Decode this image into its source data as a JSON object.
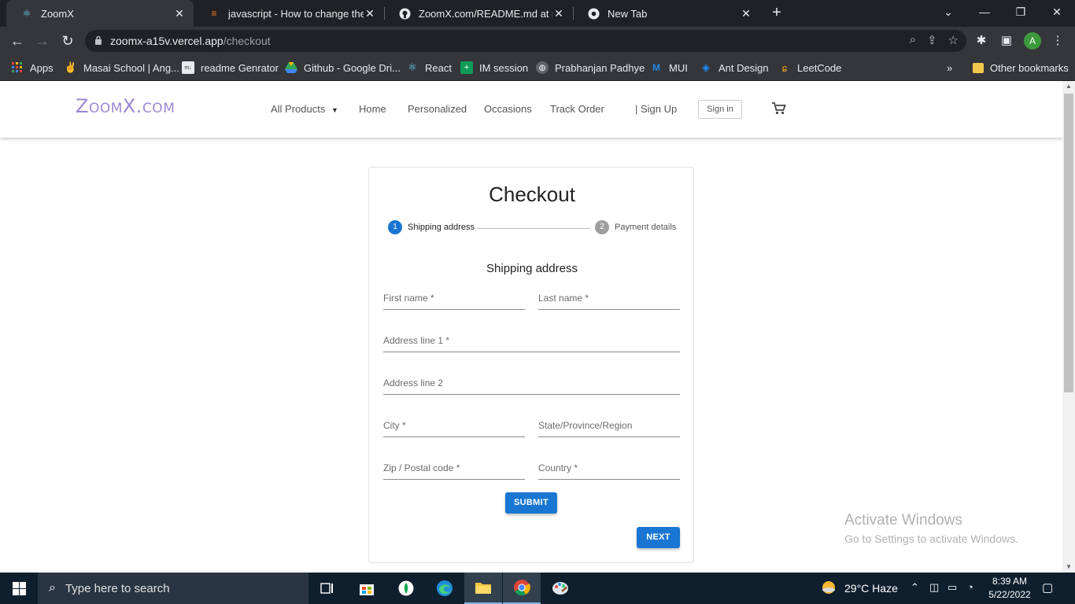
{
  "browser": {
    "tabs": [
      {
        "title": "ZoomX",
        "active": true
      },
      {
        "title": "javascript - How to change the st"
      },
      {
        "title": "ZoomX.com/README.md at main"
      },
      {
        "title": "New Tab"
      }
    ],
    "url_host": "zoomx-a15v.vercel.app",
    "url_path": "/checkout",
    "profile_initial": "A",
    "bookmarks": [
      "Apps",
      "Masai School | Ang...",
      "readme Genrator",
      "Github - Google Dri...",
      "React",
      "IM session",
      "Prabhanjan Padhye",
      "MUI",
      "Ant Design",
      "LeetCode"
    ],
    "other_bookmarks": "Other bookmarks"
  },
  "site": {
    "logo": "ZoomX.com",
    "nav": {
      "all_products": "All Products",
      "home": "Home",
      "personalized": "Personalized",
      "occasions": "Occasions",
      "track_order": "Track Order",
      "sign_up": "| Sign Up",
      "sign_in": "Sign in"
    }
  },
  "checkout": {
    "title": "Checkout",
    "steps": [
      {
        "number": "1",
        "label": "Shipping address",
        "active": true
      },
      {
        "number": "2",
        "label": "Payment details",
        "active": false
      }
    ],
    "section_title": "Shipping address",
    "fields": {
      "first_name": "First name *",
      "last_name": "Last name *",
      "address1": "Address line 1 *",
      "address2": "Address line 2",
      "city": "City *",
      "state": "State/Province/Region",
      "zip": "Zip / Postal code *",
      "country": "Country *"
    },
    "submit_label": "SUBMIT",
    "next_label": "NEXT"
  },
  "watermark": {
    "line1": "Activate Windows",
    "line2": "Go to Settings to activate Windows."
  },
  "taskbar": {
    "search_placeholder": "Type here to search",
    "weather": "29°C  Haze",
    "time": "8:39 AM",
    "date": "5/22/2022"
  },
  "colors": {
    "primary": "#1976d2",
    "logo": "#9b87d6",
    "step_inactive": "#9e9e9e"
  }
}
